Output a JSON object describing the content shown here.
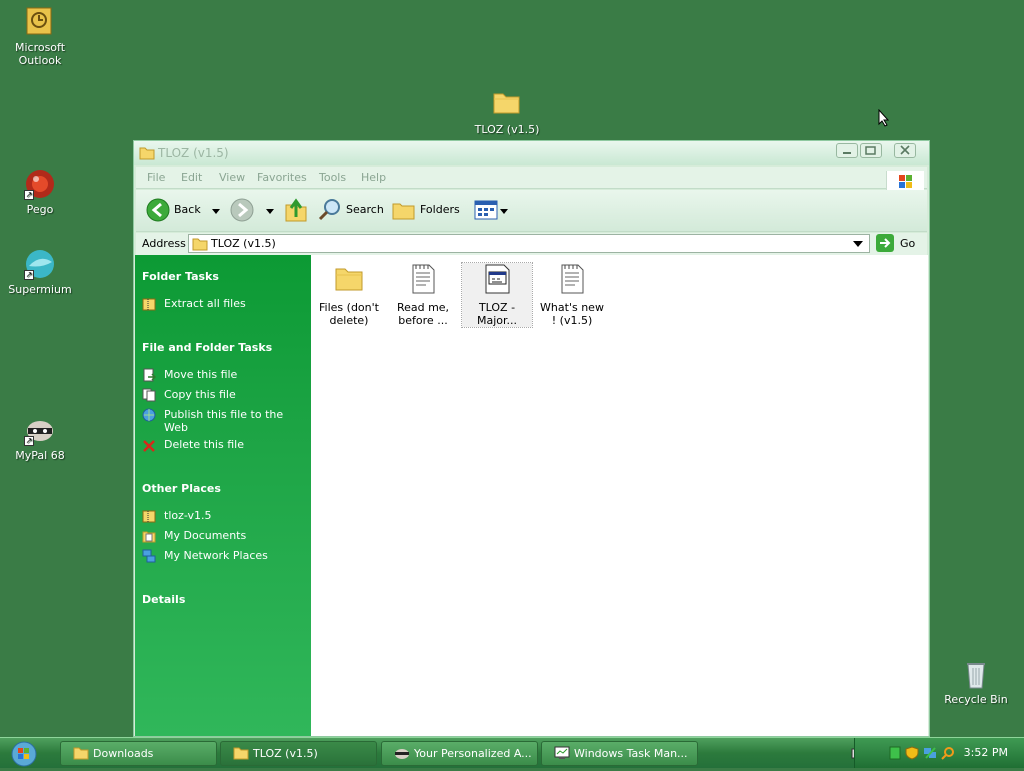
{
  "desktop": {
    "icons": [
      {
        "label": "Microsoft Outlook",
        "icon": "outlook-icon"
      },
      {
        "label": "TLOZ (v1.5)",
        "icon": "folder-icon"
      },
      {
        "label": "Pego",
        "icon": "pego-icon"
      },
      {
        "label": "Supermium",
        "icon": "supermium-icon"
      },
      {
        "label": "MyPal 68",
        "icon": "mypal-icon"
      },
      {
        "label": "Recycle Bin",
        "icon": "recycle-bin-icon"
      }
    ]
  },
  "window": {
    "title": "TLOZ (v1.5)",
    "menu": [
      "File",
      "Edit",
      "View",
      "Favorites",
      "Tools",
      "Help"
    ],
    "toolbar": {
      "back": "Back",
      "search": "Search",
      "folders": "Folders"
    },
    "address": {
      "label": "Address",
      "value": "TLOZ (v1.5)",
      "go": "Go"
    },
    "taskpane": {
      "folder_tasks": {
        "title": "Folder Tasks",
        "items": [
          "Extract all files"
        ]
      },
      "file_tasks": {
        "title": "File and Folder Tasks",
        "items": [
          "Move this file",
          "Copy this file",
          "Publish this file to the Web",
          "Delete this file"
        ]
      },
      "other_places": {
        "title": "Other Places",
        "items": [
          "tloz-v1.5",
          "My Documents",
          "My Network Places"
        ]
      },
      "details": {
        "title": "Details"
      }
    },
    "files": [
      {
        "name": "Files (don't delete)",
        "icon": "folder-icon"
      },
      {
        "name": "Read me, before ...",
        "icon": "text-file-icon"
      },
      {
        "name": "TLOZ - Major...",
        "icon": "executable-icon"
      },
      {
        "name": "What's new ! (v1.5)",
        "icon": "text-file-icon"
      }
    ]
  },
  "taskbar": {
    "buttons": [
      {
        "label": "Downloads",
        "icon": "folder-icon"
      },
      {
        "label": "TLOZ (v1.5)",
        "icon": "folder-icon"
      },
      {
        "label": "Your Personalized A...",
        "icon": "browser-icon"
      },
      {
        "label": "Windows Task Man...",
        "icon": "task-manager-icon"
      }
    ],
    "clock": "3:52 PM"
  },
  "colors": {
    "desktop": "#3a7c46",
    "taskpane": "#1ea546",
    "taskbar": "#2c7a3c"
  }
}
